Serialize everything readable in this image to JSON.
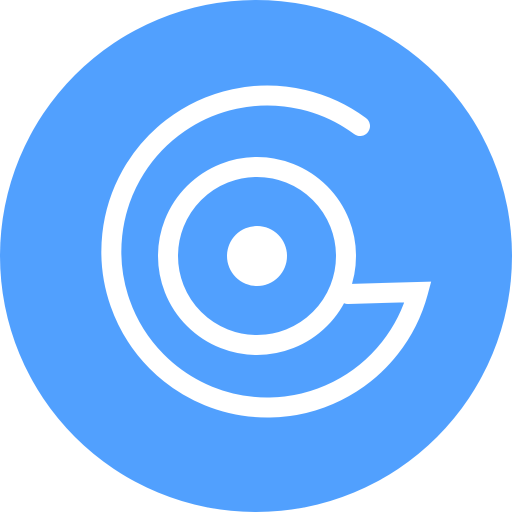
{
  "icon": {
    "name": "circular-logo-icon",
    "colors": {
      "background": "#51a0fe",
      "stroke": "#ffffff"
    }
  }
}
